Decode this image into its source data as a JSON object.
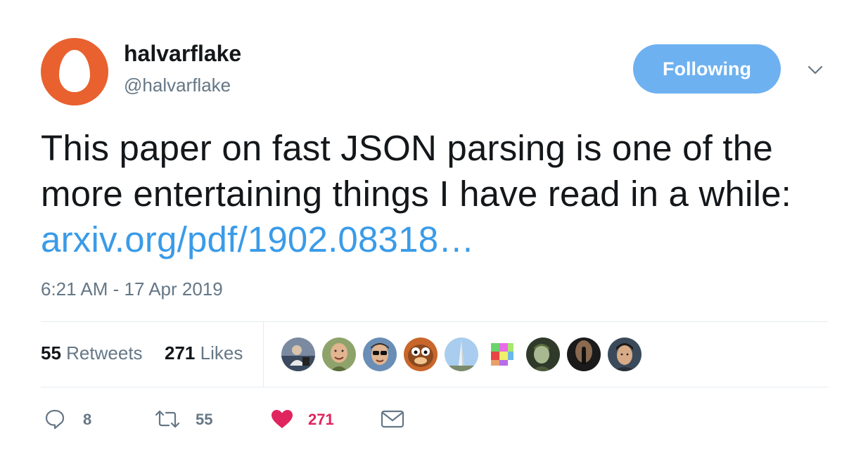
{
  "author": {
    "display_name": "halvarflake",
    "handle": "@halvarflake"
  },
  "follow_button": {
    "label": "Following"
  },
  "tweet": {
    "text": "This paper on fast JSON parsing is one of the more entertaining things I have read in a while: ",
    "link_text": "arxiv.org/pdf/1902.08318…",
    "timestamp": "6:21 AM - 17 Apr 2019"
  },
  "stats": {
    "retweets_count": "55",
    "retweets_label": "Retweets",
    "likes_count": "271",
    "likes_label": "Likes"
  },
  "actions": {
    "reply_count": "8",
    "retweet_count": "55",
    "like_count": "271"
  },
  "icons": {
    "avatar": "egg-avatar-icon",
    "caret": "chevron-down-icon",
    "reply": "reply-icon",
    "retweet": "retweet-icon",
    "like": "heart-icon",
    "dm": "envelope-icon"
  },
  "colors": {
    "brand_blue": "#6db1f0",
    "link_blue": "#3a9be8",
    "like_red": "#e0245e",
    "muted_gray": "#657786",
    "avatar_orange": "#e8612f"
  }
}
